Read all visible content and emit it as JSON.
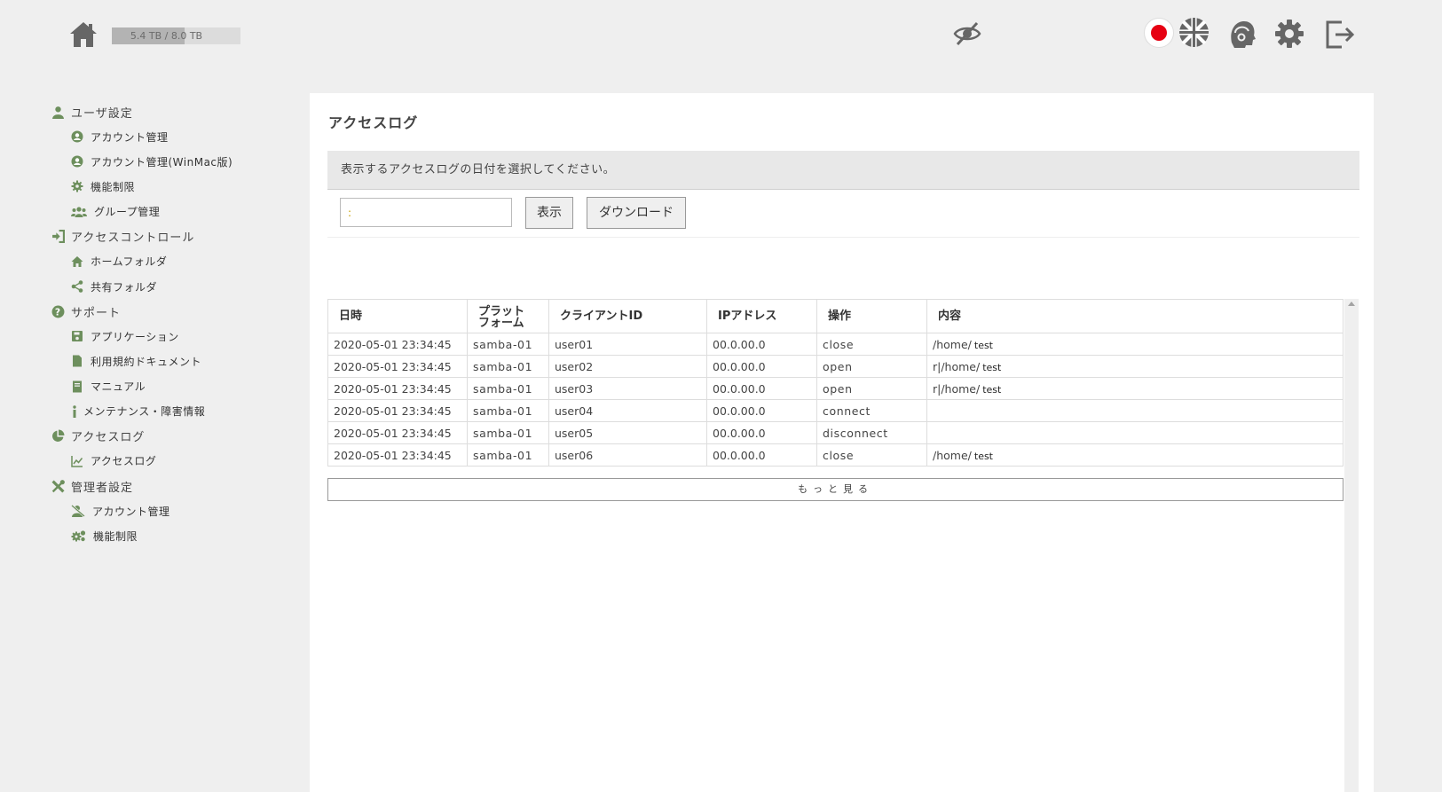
{
  "header": {
    "storage_text": "5.4 TB / 8.0 TB",
    "storage_used_fraction": 0.675,
    "icons": [
      "home-icon",
      "eye-slash-icon",
      "japan-flag-icon",
      "uk-flag-icon",
      "support-icon",
      "gear-icon",
      "logout-icon"
    ]
  },
  "colors": {
    "sidebar_icon": "#6d8f5d",
    "japan_red": "#e60012",
    "background": "#efefef"
  },
  "sidebar": {
    "groups": [
      {
        "label": "ユーザ設定",
        "icon": "user-icon",
        "items": [
          {
            "label": "アカウント管理",
            "icon": "user-circle-icon"
          },
          {
            "label": "アカウント管理(WinMac版)",
            "icon": "user-circle-icon"
          },
          {
            "label": "機能制限",
            "icon": "cog-icon"
          },
          {
            "label": "グループ管理",
            "icon": "users-icon"
          }
        ]
      },
      {
        "label": "アクセスコントロール",
        "icon": "sign-in-icon",
        "items": [
          {
            "label": "ホームフォルダ",
            "icon": "home-icon"
          },
          {
            "label": "共有フォルダ",
            "icon": "share-icon"
          }
        ]
      },
      {
        "label": "サポート",
        "icon": "question-circle-icon",
        "items": [
          {
            "label": "アプリケーション",
            "icon": "save-icon"
          },
          {
            "label": "利用規約ドキュメント",
            "icon": "file-icon"
          },
          {
            "label": "マニュアル",
            "icon": "book-icon"
          },
          {
            "label": "メンテナンス・障害情報",
            "icon": "info-icon"
          }
        ]
      },
      {
        "label": "アクセスログ",
        "icon": "pie-chart-icon",
        "items": [
          {
            "label": "アクセスログ",
            "icon": "line-chart-icon"
          }
        ]
      },
      {
        "label": "管理者設定",
        "icon": "tools-icon",
        "items": [
          {
            "label": "アカウント管理",
            "icon": "user-slash-icon"
          },
          {
            "label": "機能制限",
            "icon": "cogs-icon"
          }
        ]
      }
    ]
  },
  "main": {
    "title": "アクセスログ",
    "notice": "表示するアクセスログの日付を選択してください。",
    "date_input_value": ":",
    "show_button": "表示",
    "download_button": "ダウンロード",
    "table": {
      "columns": [
        "日時",
        "プラット\nフォーム",
        "クライアントID",
        "IPアドレス",
        "操作",
        "内容"
      ],
      "rows": [
        [
          "2020-05-01 23:34:45",
          "samba-01",
          "user01",
          "00.0.00.0",
          "close",
          "/home/",
          "test"
        ],
        [
          "2020-05-01 23:34:45",
          "samba-01",
          "user02",
          "00.0.00.0",
          "open",
          "r|/home/",
          "test"
        ],
        [
          "2020-05-01 23:34:45",
          "samba-01",
          "user03",
          "00.0.00.0",
          "open",
          "r|/home/",
          "test"
        ],
        [
          "2020-05-01 23:34:45",
          "samba-01",
          "user04",
          "00.0.00.0",
          "connect",
          "",
          ""
        ],
        [
          "2020-05-01 23:34:45",
          "samba-01",
          "user05",
          "00.0.00.0",
          "disconnect",
          "",
          ""
        ],
        [
          "2020-05-01 23:34:45",
          "samba-01",
          "user06",
          "00.0.00.0",
          "close",
          "/home/",
          "test"
        ]
      ]
    },
    "more_button": "もっと見る"
  }
}
